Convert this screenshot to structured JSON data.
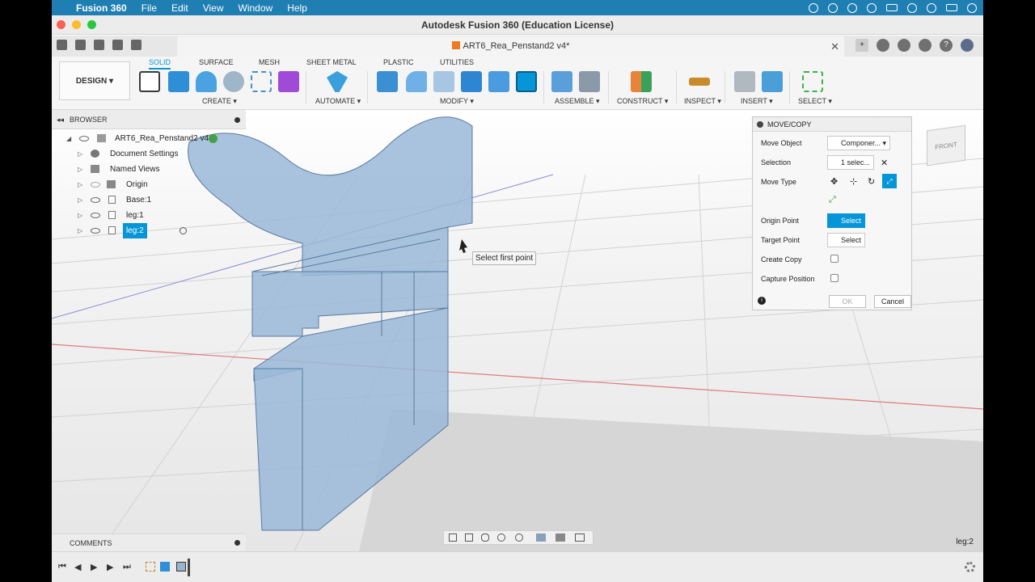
{
  "menubar": {
    "app": "Fusion 360",
    "items": [
      "File",
      "Edit",
      "View",
      "Window",
      "Help"
    ]
  },
  "window": {
    "title": "Autodesk Fusion 360 (Education License)"
  },
  "doc_tab": {
    "title": "ART6_Rea_Penstand2 v4*",
    "close": "✕"
  },
  "toolbar": {
    "design": "DESIGN ▾",
    "tabs": [
      "SOLID",
      "SURFACE",
      "MESH",
      "SHEET METAL",
      "PLASTIC",
      "UTILITIES"
    ],
    "groups": [
      "CREATE ▾",
      "AUTOMATE ▾",
      "MODIFY ▾",
      "ASSEMBLE ▾",
      "CONSTRUCT ▾",
      "INSPECT ▾",
      "INSERT ▾",
      "SELECT ▾"
    ]
  },
  "browser": {
    "header": "BROWSER",
    "root": "ART6_Rea_Penstand2 v4",
    "items": [
      "Document Settings",
      "Named Views",
      "Origin",
      "Base:1",
      "leg:1",
      "leg:2"
    ]
  },
  "tooltip": "Select first point",
  "comments": "COMMENTS",
  "status_selection": "leg:2",
  "viewcube": "FRONT",
  "dialog": {
    "title": "MOVE/COPY",
    "move_object_label": "Move Object",
    "move_object_value": "Componer...",
    "selection_label": "Selection",
    "selection_value": "1 selec...",
    "move_type_label": "Move Type",
    "origin_point_label": "Origin Point",
    "origin_point_btn": "Select",
    "target_point_label": "Target Point",
    "target_point_btn": "Select",
    "create_copy_label": "Create Copy",
    "capture_position_label": "Capture Position",
    "ok": "OK",
    "cancel": "Cancel"
  }
}
